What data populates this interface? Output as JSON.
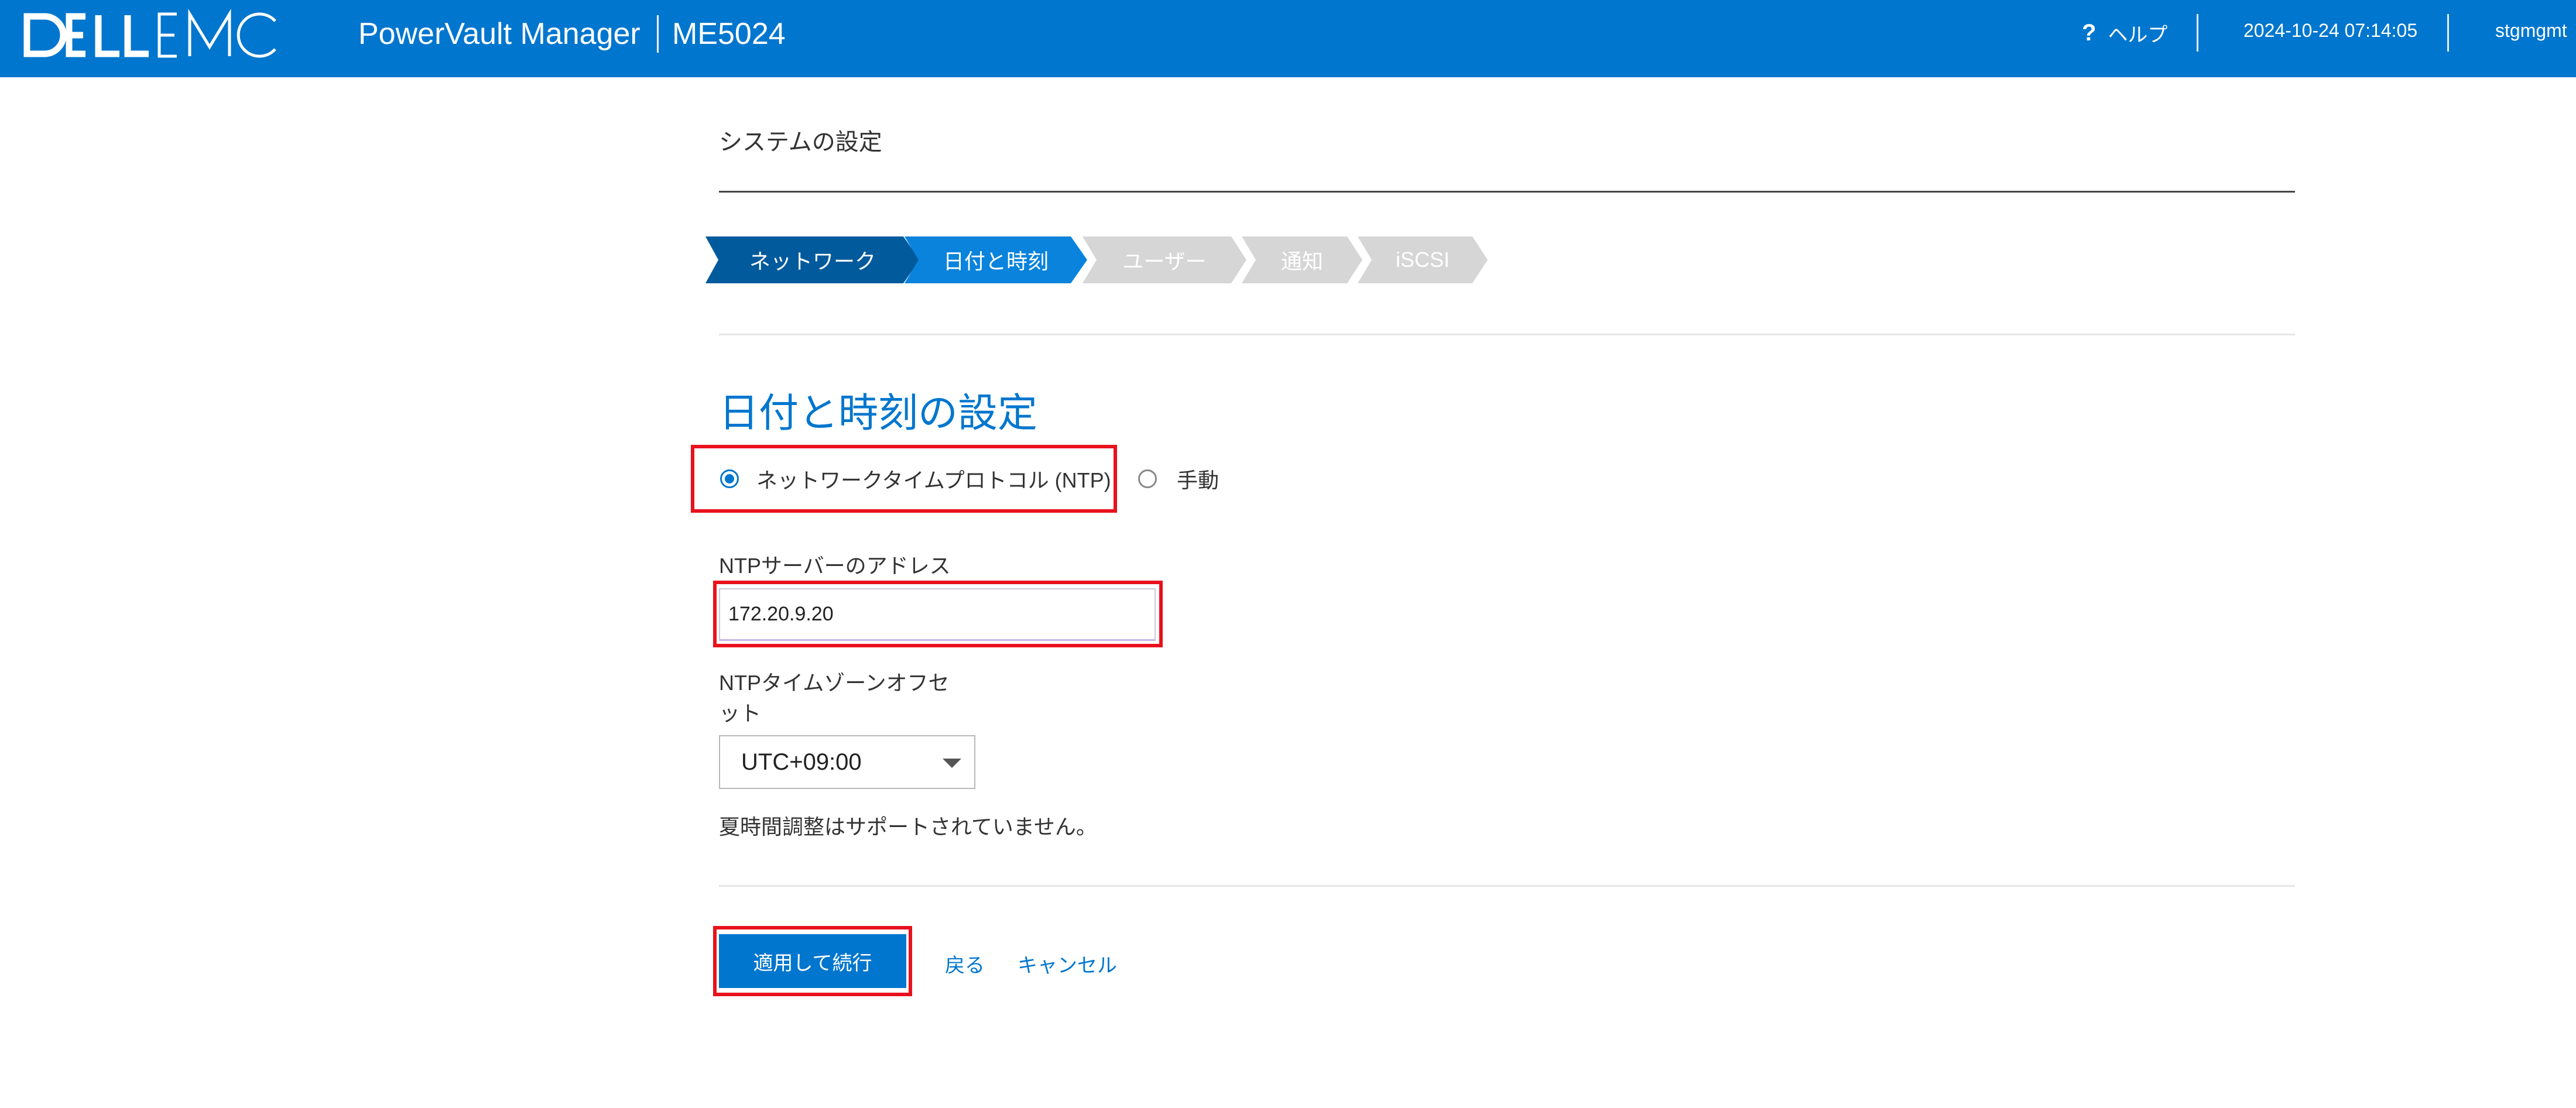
{
  "header": {
    "logo_text": "DELLEMC",
    "app_title": "PowerVault Manager",
    "model": "ME5024",
    "help_icon": "question-icon",
    "help_label": "ヘルプ",
    "datetime": "2024-10-24 07:14:05",
    "username": "stgmgmt",
    "background": "#0076ce"
  },
  "page": {
    "heading": "システムの設定"
  },
  "wizard": {
    "steps": [
      {
        "label": "ネットワーク",
        "state": "completed",
        "color": "#005a9c"
      },
      {
        "label": "日付と時刻",
        "state": "active",
        "color": "#0a83dd"
      },
      {
        "label": "ユーザー",
        "state": "pending",
        "color": "#d6d6d6"
      },
      {
        "label": "通知",
        "state": "pending",
        "color": "#d6d6d6"
      },
      {
        "label": "iSCSI",
        "state": "pending",
        "color": "#d6d6d6"
      }
    ]
  },
  "section": {
    "title": "日付と時刻の設定"
  },
  "time_mode": {
    "options": [
      {
        "label": "ネットワークタイムプロトコル (NTP)",
        "selected": true
      },
      {
        "label": "手動",
        "selected": false
      }
    ]
  },
  "ntp_server": {
    "label": "NTPサーバーのアドレス",
    "value": "172.20.9.20"
  },
  "timezone": {
    "label_line1": "NTPタイムゾーンオフセ",
    "label_line2": "ット",
    "value": "UTC+09:00"
  },
  "note": "夏時間調整はサポートされていません。",
  "actions": {
    "apply_label": "適用して続行",
    "back_label": "戻る",
    "cancel_label": "キャンセル"
  },
  "colors": {
    "accent": "#0076ce",
    "highlight": "#e8111c"
  }
}
